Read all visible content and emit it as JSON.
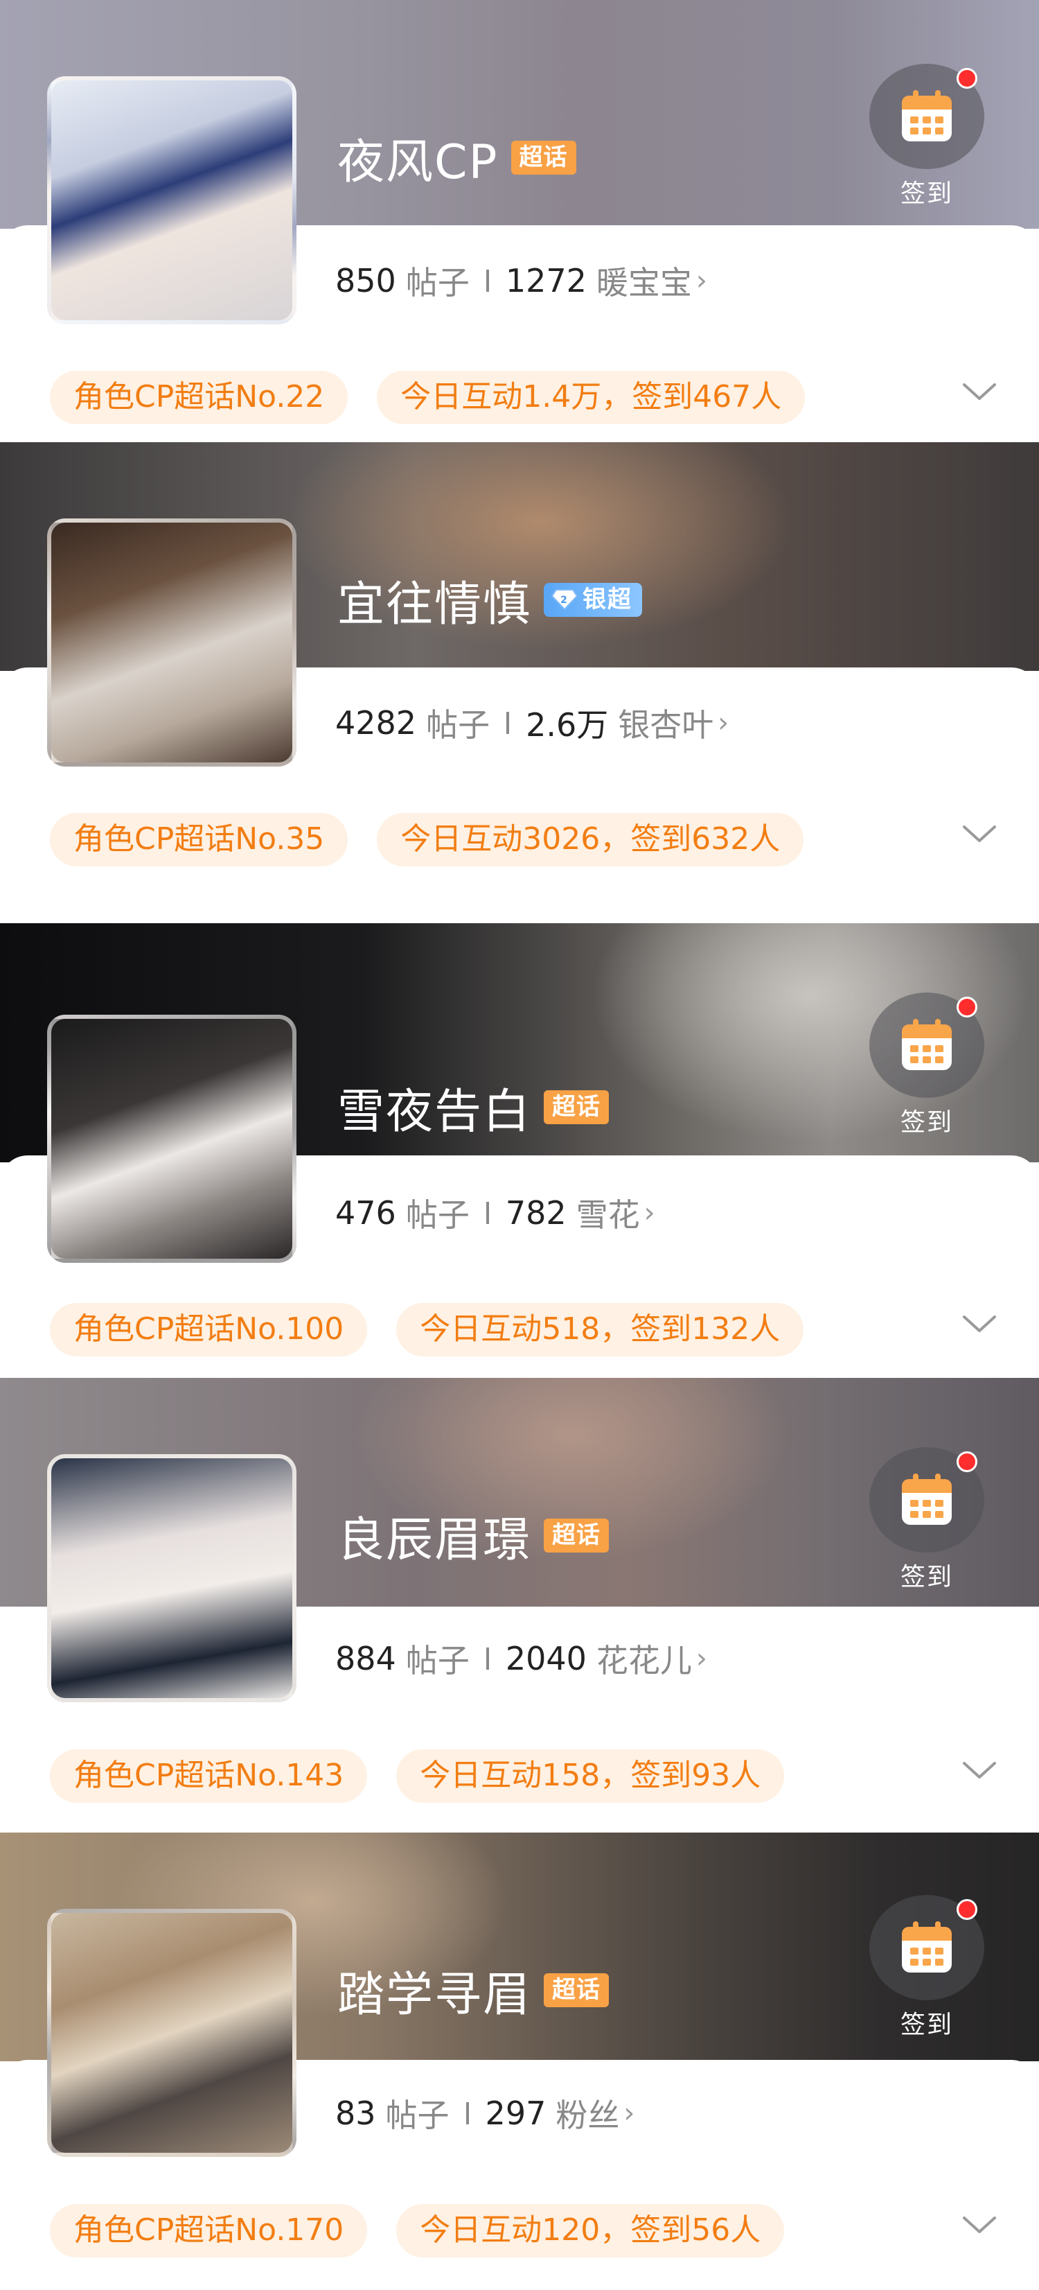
{
  "cards": [
    {
      "title": "夜风CP",
      "badge": "超话",
      "badge_type": "super",
      "has_checkin": true,
      "checkin_label": "签到",
      "posts": "850",
      "posts_label": "帖子",
      "fans": "1272",
      "fans_label": "暖宝宝",
      "rank_tag": "角色CP超话No.22",
      "activity_tag": "今日互动1.4万，签到467人"
    },
    {
      "title": "宜往情慎",
      "badge": "银超",
      "badge_type": "silver",
      "has_checkin": false,
      "posts": "4282",
      "posts_label": "帖子",
      "fans": "2.6万",
      "fans_label": "银杏叶",
      "rank_tag": "角色CP超话No.35",
      "activity_tag": "今日互动3026，签到632人"
    },
    {
      "title": "雪夜告白",
      "badge": "超话",
      "badge_type": "super",
      "has_checkin": true,
      "checkin_label": "签到",
      "posts": "476",
      "posts_label": "帖子",
      "fans": "782",
      "fans_label": "雪花",
      "rank_tag": "角色CP超话No.100",
      "activity_tag": "今日互动518，签到132人"
    },
    {
      "title": "良辰眉璟",
      "badge": "超话",
      "badge_type": "super",
      "has_checkin": true,
      "checkin_label": "签到",
      "posts": "884",
      "posts_label": "帖子",
      "fans": "2040",
      "fans_label": "花花儿",
      "rank_tag": "角色CP超话No.143",
      "activity_tag": "今日互动158，签到93人"
    },
    {
      "title": "踏学寻眉",
      "badge": "超话",
      "badge_type": "super",
      "has_checkin": true,
      "checkin_label": "签到",
      "posts": "83",
      "posts_label": "帖子",
      "fans": "297",
      "fans_label": "粉丝",
      "rank_tag": "角色CP超话No.170",
      "activity_tag": "今日互动120，签到56人"
    }
  ],
  "colors": {
    "accent_orange": "#f27d12",
    "tag_bg": "#fff1e3",
    "super_badge": "#f8a145",
    "silver_badge": "#59a6f6",
    "red_dot": "#ff2d2d"
  },
  "icons": {
    "checkin": "calendar-icon",
    "expand": "chevron-down-icon",
    "stats_arrow": "chevron-right-icon",
    "silver": "diamond-icon"
  }
}
